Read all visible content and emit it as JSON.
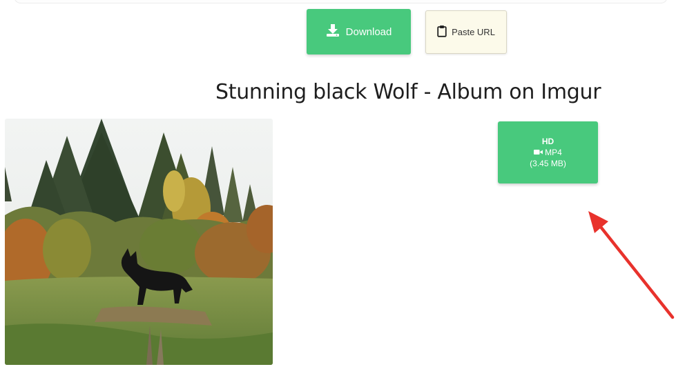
{
  "toolbar": {
    "download_label": "Download",
    "paste_label": "Paste URL"
  },
  "page_title": "Stunning black Wolf - Album on Imgur",
  "media": {
    "quality": "HD",
    "format": "MP4",
    "size": "(3.45 MB)"
  },
  "icons": {
    "download": "download-icon",
    "paste": "clipboard-icon",
    "video": "video-camera-icon"
  },
  "colors": {
    "accent_green": "#48c97d",
    "paste_bg": "#fcfaea",
    "arrow_red": "#e8322c"
  }
}
